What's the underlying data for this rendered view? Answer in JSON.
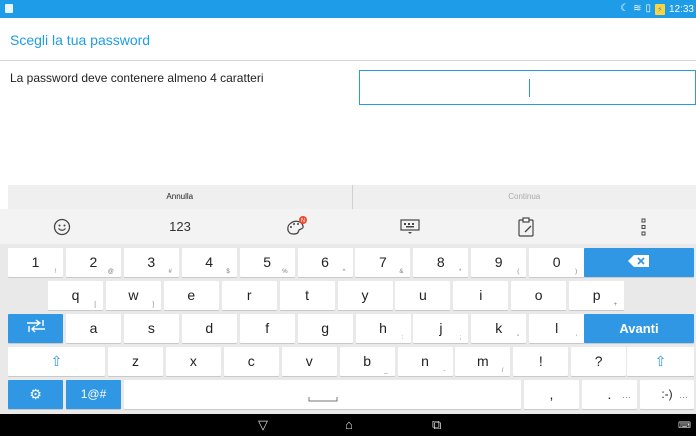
{
  "status": {
    "time": "12:33",
    "icons": [
      "moon-icon",
      "wifi-icon",
      "nfc-icon",
      "battery-icon"
    ]
  },
  "title": "Scegli la tua password",
  "message": "La password deve contenere almeno 4 caratteri",
  "actions": {
    "cancel": "Annulla",
    "continue": "Continua"
  },
  "toolbar": {
    "numbers": "123"
  },
  "rows": {
    "numbers": [
      {
        "k": "1",
        "s": "!"
      },
      {
        "k": "2",
        "s": "@"
      },
      {
        "k": "3",
        "s": "#"
      },
      {
        "k": "4",
        "s": "$"
      },
      {
        "k": "5",
        "s": "%"
      },
      {
        "k": "6",
        "s": "^"
      },
      {
        "k": "7",
        "s": "&"
      },
      {
        "k": "8",
        "s": "*"
      },
      {
        "k": "9",
        "s": "("
      },
      {
        "k": "0",
        "s": ")"
      }
    ],
    "top": [
      {
        "k": "q",
        "s": "["
      },
      {
        "k": "w",
        "s": "]"
      },
      {
        "k": "e",
        "s": ""
      },
      {
        "k": "r",
        "s": ""
      },
      {
        "k": "t",
        "s": ""
      },
      {
        "k": "y",
        "s": ""
      },
      {
        "k": "u",
        "s": ""
      },
      {
        "k": "i",
        "s": ""
      },
      {
        "k": "o",
        "s": ""
      },
      {
        "k": "p",
        "s": "+"
      }
    ],
    "middle": [
      {
        "k": "a",
        "s": ""
      },
      {
        "k": "s",
        "s": ""
      },
      {
        "k": "d",
        "s": ""
      },
      {
        "k": "f",
        "s": ""
      },
      {
        "k": "g",
        "s": ""
      },
      {
        "k": "h",
        "s": ":"
      },
      {
        "k": "j",
        "s": ";"
      },
      {
        "k": "k",
        "s": "\""
      },
      {
        "k": "l",
        "s": "'"
      }
    ],
    "bottom": [
      {
        "k": "z",
        "s": ""
      },
      {
        "k": "x",
        "s": ""
      },
      {
        "k": "c",
        "s": ""
      },
      {
        "k": "v",
        "s": ""
      },
      {
        "k": "b",
        "s": "_"
      },
      {
        "k": "n",
        "s": "-"
      },
      {
        "k": "m",
        "s": "/"
      },
      {
        "k": "!",
        "s": ""
      },
      {
        "k": "?",
        "s": ""
      }
    ]
  },
  "keys": {
    "enter": "Avanti",
    "symbols": "1@#",
    "comma": ",",
    "period": ".",
    "smiley": ":-)"
  },
  "colors": {
    "accent": "#1e9ce8",
    "key_blue": "#2f97e4"
  }
}
